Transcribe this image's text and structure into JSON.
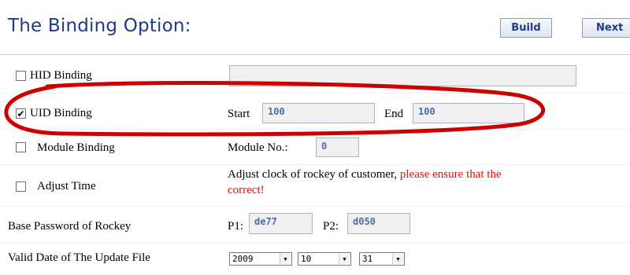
{
  "header": {
    "title": "The Binding Option:",
    "build_label": "Build",
    "next_label": "Next"
  },
  "hid": {
    "label": "HID Binding",
    "checked": false,
    "value": ""
  },
  "uid": {
    "label": "UID Binding",
    "checked": true,
    "start_label": "Start",
    "start_value": "100",
    "end_label": "End",
    "end_value": "100"
  },
  "module": {
    "label": "Module Binding",
    "checked": false,
    "no_label": "Module No.:",
    "no_value": "0"
  },
  "adjust": {
    "label": "Adjust Time",
    "checked": false,
    "text_black": "Adjust clock of rockey of customer, ",
    "text_red_1": "please ensure that the",
    "text_red_2": "correct!"
  },
  "password": {
    "label": "Base Password of Rockey",
    "p1_label": "P1:",
    "p1_value": "de77",
    "p2_label": "P2:",
    "p2_value": "d050"
  },
  "valid_date": {
    "label": "Valid Date of The Update File",
    "year": "2009",
    "month": "10",
    "day": "31"
  },
  "colors": {
    "title": "#1f3a8a",
    "highlight_oval": "#cc0000",
    "warning_text": "#ff0000",
    "field_text": "#4a6ea8"
  }
}
